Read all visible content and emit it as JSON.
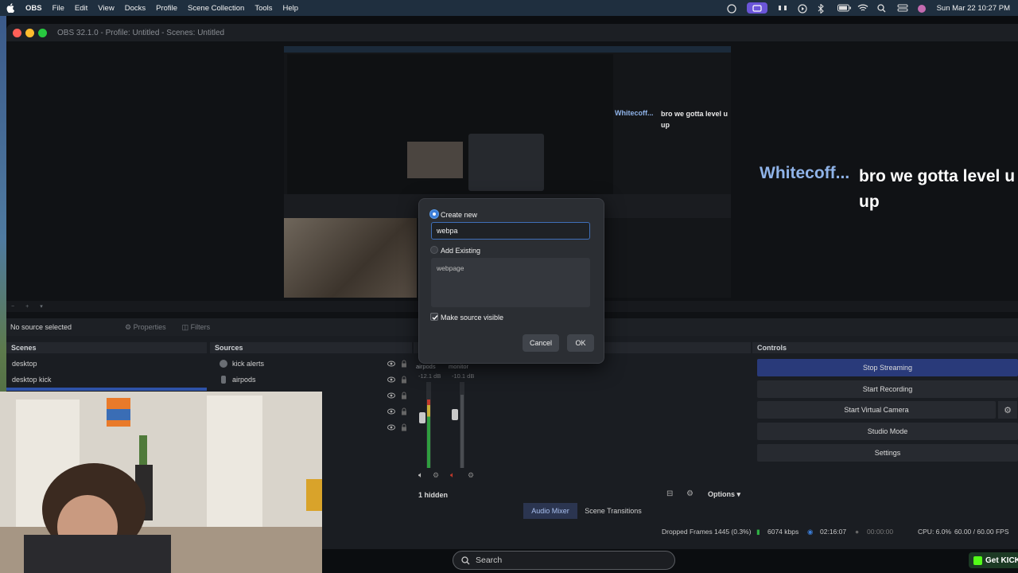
{
  "menubar": {
    "app": "OBS",
    "items": [
      "File",
      "Edit",
      "View",
      "Docks",
      "Profile",
      "Scene Collection",
      "Tools",
      "Help"
    ],
    "datetime": "Sun Mar 22  10:27 PM"
  },
  "window": {
    "title": "OBS 32.1.0 - Profile: Untitled - Scenes: Untitled"
  },
  "preview": {
    "chat_small_name": "Whitecoff...",
    "chat_small_msg": "bro we gotta level u up",
    "chat_big_name": "Whitecoff...",
    "chat_big_msg": "bro we gotta level u up"
  },
  "propbar": {
    "no_source": "No source selected",
    "properties": "Properties",
    "filters": "Filters"
  },
  "scenes": {
    "title": "Scenes",
    "items": [
      "desktop",
      "desktop kick"
    ]
  },
  "sources": {
    "title": "Sources",
    "items": [
      "kick alerts",
      "airpods"
    ]
  },
  "mixer": {
    "channels": [
      {
        "name": "airpods",
        "db": "-12.1 dB"
      },
      {
        "name": "monitor",
        "db": "-10.1 dB"
      }
    ],
    "hidden": "1 hidden",
    "options": "Options",
    "tabs": [
      "Audio Mixer",
      "Scene Transitions"
    ]
  },
  "controls": {
    "title": "Controls",
    "buttons": [
      "Stop Streaming",
      "Start Recording",
      "Start Virtual Camera",
      "Studio Mode",
      "Settings"
    ]
  },
  "status": {
    "dropped": "Dropped Frames 1445 (0.3%)",
    "bitrate": "6074 kbps",
    "stream_time": "02:16:07",
    "rec_time": "00:00:00",
    "cpu": "CPU: 6.0%",
    "fps": "60.00 / 60.00 FPS"
  },
  "dialog": {
    "create_new": "Create new",
    "input_value": "webpa",
    "add_existing": "Add Existing",
    "existing_items": [
      "webpage"
    ],
    "make_visible": "Make source visible",
    "cancel": "Cancel",
    "ok": "OK"
  },
  "dock": {
    "search_placeholder": "Search",
    "get_kick": "Get KICK"
  },
  "colors": {
    "accent": "#3b7dd8",
    "streaming_active": "#293a7a",
    "chat_name": "#8fb3e8",
    "kick_green": "#53fc18"
  }
}
